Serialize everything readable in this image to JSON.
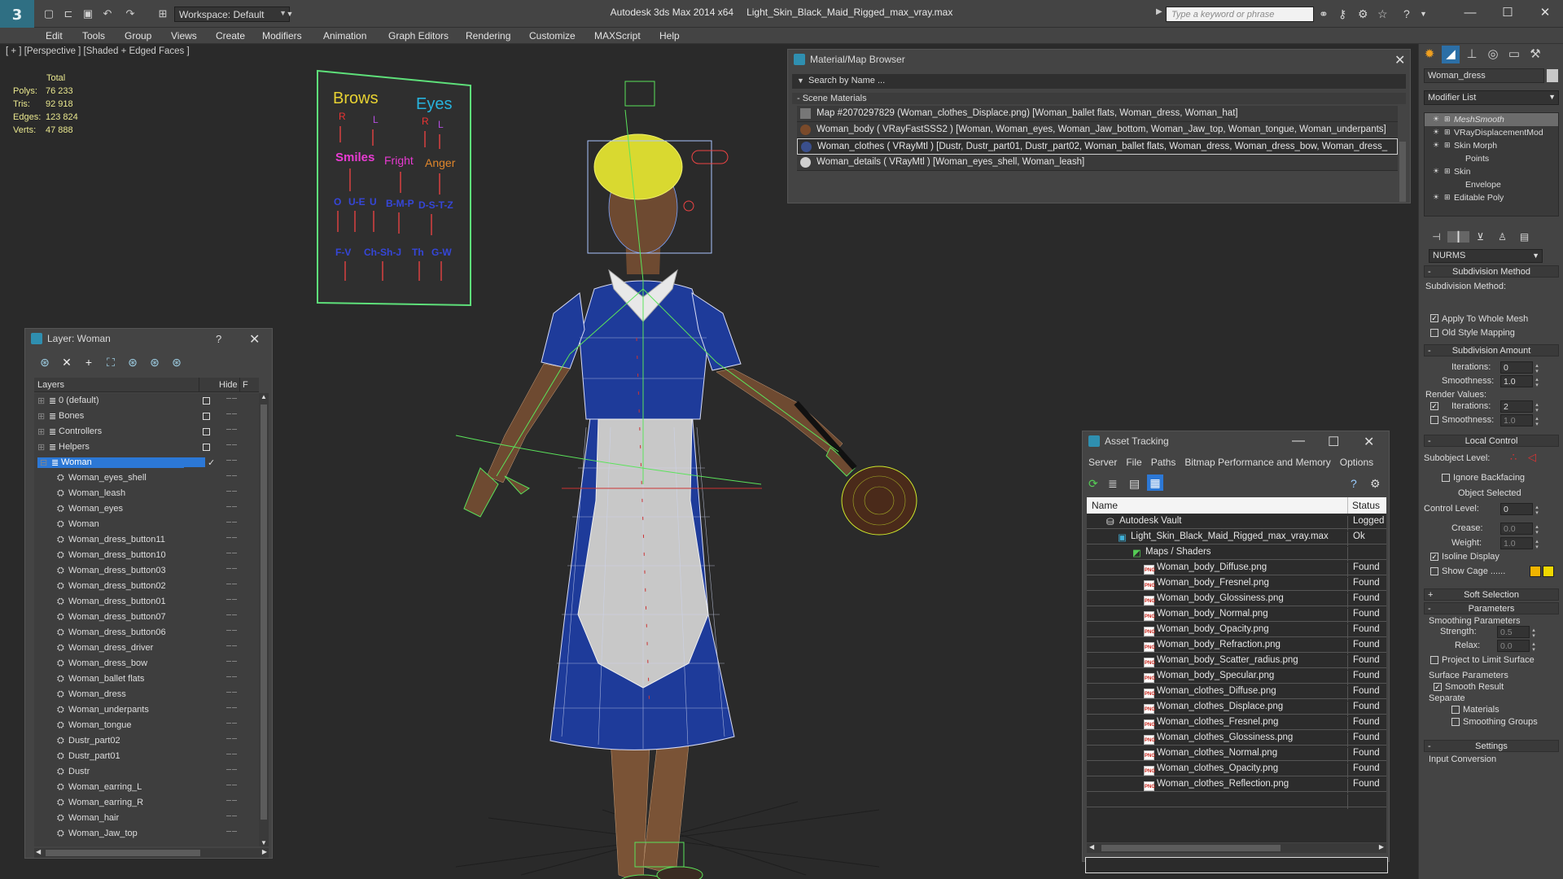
{
  "window": {
    "app_title": "Autodesk 3ds Max  2014 x64",
    "file_title": "Light_Skin_Black_Maid_Rigged_max_vray.max",
    "workspace": "Workspace: Default",
    "search_placeholder": "Type a keyword or phrase",
    "logo": "3"
  },
  "menu": [
    "Edit",
    "Tools",
    "Group",
    "Views",
    "Create",
    "Modifiers",
    "Animation",
    "Graph Editors",
    "Rendering",
    "Customize",
    "MAXScript",
    "Help"
  ],
  "viewport": {
    "label": "[ + ] [Perspective ] [Shaded + Edged Faces ]",
    "stats": {
      "header": "Total",
      "rows": [
        {
          "label": "Polys:",
          "value": "76 233"
        },
        {
          "label": "Tris:",
          "value": "92 918"
        },
        {
          "label": "Edges:",
          "value": "123 824"
        },
        {
          "label": "Verts:",
          "value": "47 888"
        }
      ]
    },
    "facial_board": {
      "brows": "Brows",
      "eyes": "Eyes",
      "r1": "R",
      "l1": "L",
      "r2": "R",
      "l2": "L",
      "smiles": "Smiles",
      "fright": "Fright",
      "anger": "Anger",
      "row3": [
        "O",
        "U-E",
        "U",
        "B-M-P",
        "D-S-T-Z"
      ],
      "row4": [
        "F-V",
        "Ch-Sh-J",
        "Th",
        "G-W"
      ]
    }
  },
  "material_browser": {
    "title": "Material/Map Browser",
    "search": "Search by Name ...",
    "section": "- Scene Materials",
    "rows": [
      {
        "text": "Map #2070297829 (Woman_clothes_Displace.png) [Woman_ballet flats, Woman_dress, Woman_hat]",
        "swatch": "#1a1a1a"
      },
      {
        "text": "Woman_body  ( VRayFastSSS2 ) [Woman, Woman_eyes, Woman_Jaw_bottom, Woman_Jaw_top, Woman_tongue, Woman_underpants]",
        "swatch": "#7a4a2a"
      },
      {
        "text": "Woman_clothes  ( VRayMtl ) [Dustr, Dustr_part01, Dustr_part02, Woman_ballet flats, Woman_dress, Woman_dress_bow, Woman_dress_",
        "swatch": "#3a4f8c"
      },
      {
        "text": "Woman_details  ( VRayMtl ) [Woman_eyes_shell, Woman_leash]",
        "swatch": "#cfcfcf"
      }
    ]
  },
  "layer_panel": {
    "title": "Layer: Woman",
    "help": "?",
    "col_layers": "Layers",
    "col_hide": "Hide",
    "col_f": "F",
    "top_layers": [
      {
        "name": "0 (default)"
      },
      {
        "name": "Bones"
      },
      {
        "name": "Controllers"
      },
      {
        "name": "Helpers"
      },
      {
        "name": "Woman"
      }
    ],
    "objects": [
      "Woman_eyes_shell",
      "Woman_leash",
      "Woman_eyes",
      "Woman",
      "Woman_dress_button11",
      "Woman_dress_button10",
      "Woman_dress_button03",
      "Woman_dress_button02",
      "Woman_dress_button01",
      "Woman_dress_button07",
      "Woman_dress_button06",
      "Woman_dress_driver",
      "Woman_dress_bow",
      "Woman_ballet flats",
      "Woman_dress",
      "Woman_underpants",
      "Woman_tongue",
      "Dustr_part02",
      "Dustr_part01",
      "Dustr",
      "Woman_earring_L",
      "Woman_earring_R",
      "Woman_hair",
      "Woman_Jaw_top"
    ]
  },
  "asset_tracking": {
    "title": "Asset Tracking",
    "menu": [
      "Server",
      "File",
      "Paths",
      "Bitmap Performance and Memory",
      "Options"
    ],
    "col_name": "Name",
    "col_status": "Status",
    "vault": {
      "name": "Autodesk Vault",
      "status": "Logged O"
    },
    "file": {
      "name": "Light_Skin_Black_Maid_Rigged_max_vray.max",
      "status": "Ok"
    },
    "group": "Maps / Shaders",
    "found": "Found",
    "maps": [
      "Woman_body_Diffuse.png",
      "Woman_body_Fresnel.png",
      "Woman_body_Glossiness.png",
      "Woman_body_Normal.png",
      "Woman_body_Opacity.png",
      "Woman_body_Refraction.png",
      "Woman_body_Scatter_radius.png",
      "Woman_body_Specular.png",
      "Woman_clothes_Diffuse.png",
      "Woman_clothes_Displace.png",
      "Woman_clothes_Fresnel.png",
      "Woman_clothes_Glossiness.png",
      "Woman_clothes_Normal.png",
      "Woman_clothes_Opacity.png",
      "Woman_clothes_Reflection.png"
    ]
  },
  "command_panel": {
    "object_name": "Woman_dress",
    "modifier_list": "Modifier List",
    "stack": [
      {
        "name": "MeshSmooth",
        "indent": 0,
        "sel": true
      },
      {
        "name": "VRayDisplacementMod",
        "indent": 0,
        "sel": false
      },
      {
        "name": "Skin Morph",
        "indent": 0,
        "sel": false
      },
      {
        "name": "Points",
        "indent": 1,
        "sel": false
      },
      {
        "name": "Skin",
        "indent": 0,
        "sel": false
      },
      {
        "name": "Envelope",
        "indent": 1,
        "sel": false
      },
      {
        "name": "Editable Poly",
        "indent": 0,
        "sel": false
      }
    ],
    "subdivision_method_head": "Subdivision Method",
    "subdivision_method_label": "Subdivision Method:",
    "nurms": "NURMS",
    "apply_whole_mesh": "Apply To Whole Mesh",
    "old_style_mapping": "Old Style Mapping",
    "subdivision_amount_head": "Subdivision Amount",
    "iterations_label": "Iterations:",
    "iterations": "0",
    "smoothness_label": "Smoothness:",
    "smoothness": "1.0",
    "render_values": "Render Values:",
    "render_iterations": "2",
    "render_smoothness": "1.0",
    "local_control_head": "Local Control",
    "subobject_level": "Subobject Level:",
    "ignore_backfacing": "Ignore Backfacing",
    "object_selected": "Object Selected",
    "control_level": "Control Level:",
    "control_level_val": "0",
    "crease_label": "Crease:",
    "crease": "0.0",
    "weight_label": "Weight:",
    "weight": "1.0",
    "isoline_display": "Isoline Display",
    "show_cage": "Show Cage ......",
    "soft_selection_head": "Soft Selection",
    "parameters_head": "Parameters",
    "smoothing_params": "Smoothing Parameters",
    "strength_label": "Strength:",
    "strength": "0.5",
    "relax_label": "Relax:",
    "relax": "0.0",
    "project_limit": "Project to Limit Surface",
    "surface_params": "Surface Parameters",
    "smooth_result": "Smooth Result",
    "separate": "Separate",
    "materials": "Materials",
    "smoothing_groups": "Smoothing Groups",
    "settings_head": "Settings",
    "input_conversion": "Input Conversion",
    "colors": {
      "cage1": "#f0b400",
      "cage2": "#f0d800"
    }
  }
}
